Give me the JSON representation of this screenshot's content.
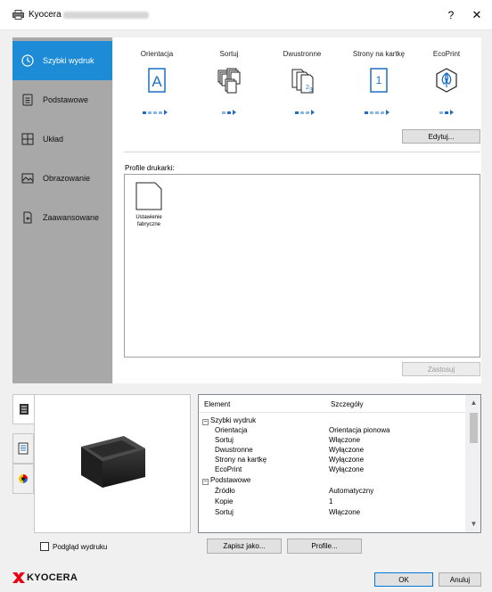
{
  "window": {
    "title": "Kyocera",
    "help": "?",
    "close": "✕"
  },
  "nav": {
    "items": [
      {
        "label": "Szybki wydruk",
        "icon": "clock-icon"
      },
      {
        "label": "Podstawowe",
        "icon": "document-icon"
      },
      {
        "label": "Układ",
        "icon": "layout-icon"
      },
      {
        "label": "Obrazowanie",
        "icon": "image-icon"
      },
      {
        "label": "Zaawansowane",
        "icon": "advanced-icon"
      }
    ]
  },
  "quick_print": {
    "options": [
      {
        "label": "Orientacja",
        "icon": "orientation-portrait-icon"
      },
      {
        "label": "Sortuj",
        "icon": "collate-icon"
      },
      {
        "label": "Dwustronne",
        "icon": "duplex-icon"
      },
      {
        "label": "Strony na kartkę",
        "icon": "pages-per-sheet-icon",
        "value": "1"
      },
      {
        "label": "EcoPrint",
        "icon": "ecoprint-icon"
      }
    ],
    "edit_button": "Edytuj...",
    "profiles_label": "Profile drukarki:",
    "profiles": [
      {
        "label": "Ustawienie fabryczne"
      }
    ],
    "apply_button": "Zastosuj"
  },
  "details": {
    "columns": [
      "Element",
      "Szczegóły"
    ],
    "rows": [
      {
        "group": true,
        "expander": "⊟",
        "name": "Szybki wydruk",
        "value": ""
      },
      {
        "name": "Orientacja",
        "value": "Orientacja pionowa"
      },
      {
        "name": "Sortuj",
        "value": "Włączone"
      },
      {
        "name": "Dwustronne",
        "value": "Wyłączone"
      },
      {
        "name": "Strony na kartkę",
        "value": "Wyłączone"
      },
      {
        "name": "EcoPrint",
        "value": "Wyłączone"
      },
      {
        "group": true,
        "expander": "⊟",
        "name": "Podstawowe",
        "value": ""
      },
      {
        "name": "Źródło",
        "value": "Automatyczny"
      },
      {
        "name": "Kopie",
        "value": "1"
      },
      {
        "name": "Sortuj",
        "value": "Włączone"
      }
    ]
  },
  "bottom": {
    "preview_label": "Podgląd wydruku",
    "save_as": "Zapisz jako...",
    "profiles": "Profile...",
    "ok": "OK",
    "cancel": "Anuluj",
    "brand": "KYOCERA"
  },
  "colors": {
    "accent": "#1e8bd6",
    "nav_bg": "#a8a8a8",
    "brand_red": "#e60012"
  }
}
